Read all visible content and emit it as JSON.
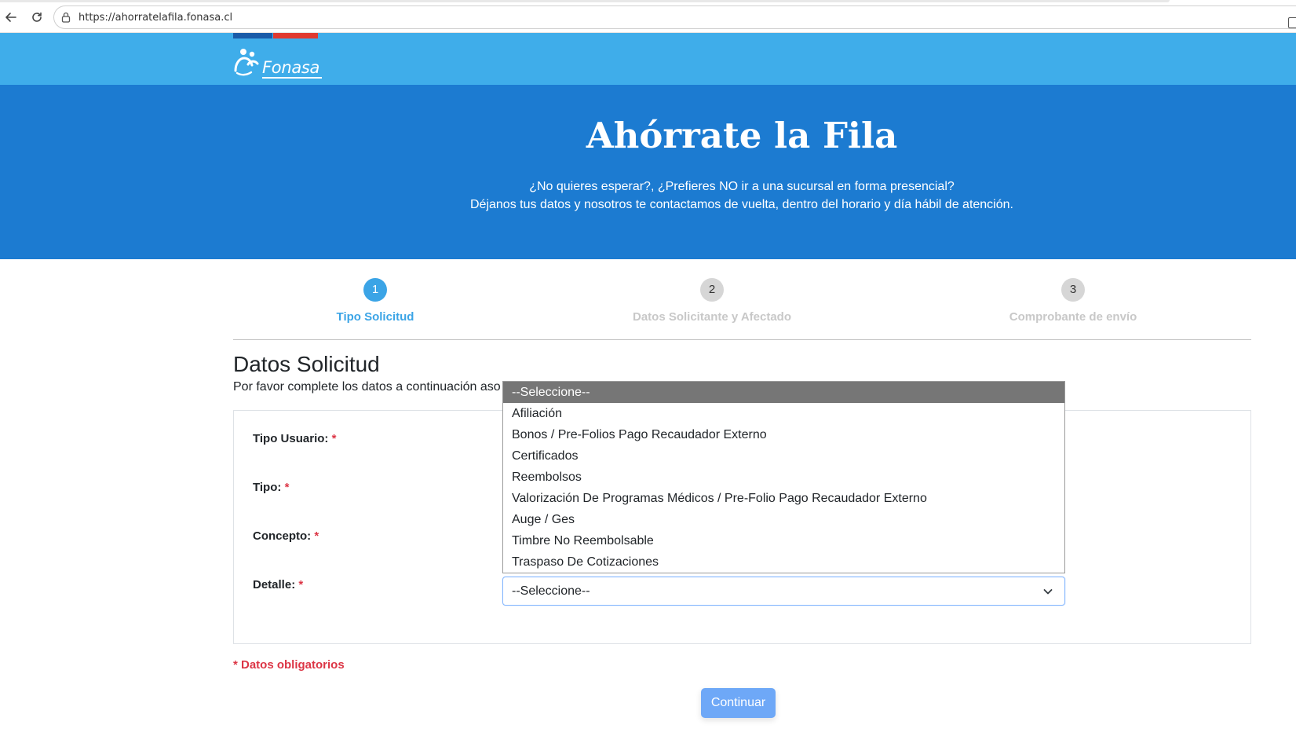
{
  "browser": {
    "url": "https://ahorratelafila.fonasa.cl",
    "back_icon": "arrow-left-icon",
    "reload_icon": "reload-icon"
  },
  "header": {
    "logo_text": "Fonasa",
    "colors": {
      "header_bg": "#3fadea",
      "hero_bg": "#1c7bd1",
      "stripe_blue": "#1a5ba8",
      "stripe_red": "#e0392f"
    }
  },
  "hero": {
    "title": "Ahórrate la Fila",
    "subtitle_line1": "¿No quieres esperar?, ¿Prefieres NO ir a una sucursal en forma presencial?",
    "subtitle_line2": "Déjanos tus datos y nosotros te contactamos de vuelta, dentro del horario y día hábil de atención."
  },
  "steps": [
    {
      "number": "1",
      "label": "Tipo Solicitud",
      "state": "active"
    },
    {
      "number": "2",
      "label": "Datos Solicitante y Afectado",
      "state": "inactive"
    },
    {
      "number": "3",
      "label": "Comprobante de envío",
      "state": "inactive"
    }
  ],
  "section": {
    "title": "Datos Solicitud",
    "description": "Por favor complete los datos a continuación aso"
  },
  "form": {
    "fields": [
      {
        "label": "Tipo Usuario:",
        "required_mark": "*"
      },
      {
        "label": "Tipo:",
        "required_mark": "*"
      },
      {
        "label": "Concepto:",
        "required_mark": "*"
      },
      {
        "label": "Detalle:",
        "required_mark": "*"
      }
    ],
    "detalle_select": {
      "value": "--Seleccione--"
    },
    "dropdown_options": [
      "--Seleccione--",
      "Afiliación",
      "Bonos / Pre-Folios Pago Recaudador Externo",
      "Certificados",
      "Reembolsos",
      "Valorización De Programas Médicos / Pre-Folio Pago Recaudador Externo",
      "Auge / Ges",
      "Timbre No Reembolsable",
      "Traspaso De Cotizaciones"
    ],
    "highlighted_option_index": 0
  },
  "footer": {
    "required_note": "* Datos obligatorios",
    "continue_label": "Continuar"
  }
}
